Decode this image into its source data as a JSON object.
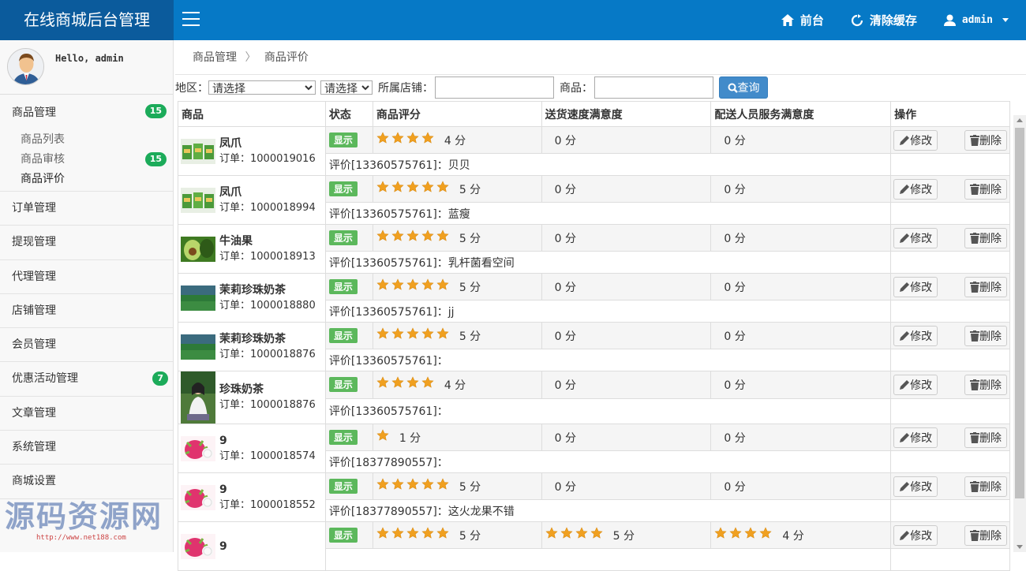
{
  "header": {
    "brand": "在线商城后台管理",
    "frontend": "前台",
    "clear_cache": "清除缓存",
    "user": "admin"
  },
  "sidebar": {
    "hello": "Hello, admin",
    "menu": [
      {
        "label": "商品管理",
        "badge": "15",
        "sub": [
          {
            "label": "商品列表"
          },
          {
            "label": "商品审核",
            "badge": "15"
          },
          {
            "label": "商品评价"
          }
        ]
      },
      {
        "label": "订单管理"
      },
      {
        "label": "提现管理"
      },
      {
        "label": "代理管理"
      },
      {
        "label": "店铺管理"
      },
      {
        "label": "会员管理"
      },
      {
        "label": "优惠活动管理",
        "badge": "7"
      },
      {
        "label": "文章管理"
      },
      {
        "label": "系统管理"
      },
      {
        "label": "商城设置"
      }
    ]
  },
  "breadcrumb": {
    "parent": "商品管理",
    "current": "商品评价",
    "sep": "〉"
  },
  "filter": {
    "region_label": "地区：",
    "region_select": "请选择",
    "sub_select": "请选择",
    "shop_label": "所属店铺：",
    "product_label": "商品：",
    "query_button": "查询"
  },
  "table": {
    "headers": [
      "商品",
      "状态",
      "商品评分",
      "送货速度满意度",
      "配送人员服务满意度",
      "操作"
    ],
    "status_label": "显示",
    "order_prefix": "订单：",
    "edit": "修改",
    "delete": "删除",
    "rows": [
      {
        "name": "凤爪",
        "order": "1000019016",
        "rating": 4,
        "rating_text": "4 分",
        "speed": 0,
        "speed_text": "0 分",
        "service": 0,
        "service_text": "0 分",
        "eval": "评价[13360575761]：贝贝",
        "img": "box-green"
      },
      {
        "name": "凤爪",
        "order": "1000018994",
        "rating": 5,
        "rating_text": "5 分",
        "speed": 0,
        "speed_text": "0 分",
        "service": 0,
        "service_text": "0 分",
        "eval": "评价[13360575761]：蓝瘦",
        "img": "box-green"
      },
      {
        "name": "牛油果",
        "order": "1000018913",
        "rating": 5,
        "rating_text": "5 分",
        "speed": 0,
        "speed_text": "0 分",
        "service": 0,
        "service_text": "0 分",
        "eval": "评价[13360575761]：乳杆菌看空间",
        "img": "avocado"
      },
      {
        "name": "茉莉珍珠奶茶",
        "order": "1000018880",
        "rating": 5,
        "rating_text": "5 分",
        "speed": 0,
        "speed_text": "0 分",
        "service": 0,
        "service_text": "0 分",
        "eval": "评价[13360575761]：jj",
        "img": "field"
      },
      {
        "name": "茉莉珍珠奶茶",
        "order": "1000018876",
        "rating": 5,
        "rating_text": "5 分",
        "speed": 0,
        "speed_text": "0 分",
        "service": 0,
        "service_text": "0 分",
        "eval": "评价[13360575761]：",
        "img": "field"
      },
      {
        "name": "珍珠奶茶",
        "order": "1000018876",
        "rating": 4,
        "rating_text": "4 分",
        "speed": 0,
        "speed_text": "0 分",
        "service": 0,
        "service_text": "0 分",
        "eval": "评价[13360575761]：",
        "img": "person",
        "tall": true
      },
      {
        "name": "9",
        "order": "1000018574",
        "rating": 1,
        "rating_text": "1 分",
        "speed": 0,
        "speed_text": "0 分",
        "service": 0,
        "service_text": "0 分",
        "eval": "评价[18377890557]：",
        "img": "dragonfruit"
      },
      {
        "name": "9",
        "order": "1000018552",
        "rating": 5,
        "rating_text": "5 分",
        "speed": 0,
        "speed_text": "0 分",
        "service": 0,
        "service_text": "0 分",
        "eval": "评价[18377890557]：这火龙果不错",
        "img": "dragonfruit"
      },
      {
        "name": "9",
        "order": "",
        "rating": 5,
        "rating_text": "5 分",
        "speed": 4,
        "speed_text": "5 分",
        "service": 4,
        "service_text": "4 分",
        "eval": "",
        "img": "dragonfruit"
      }
    ]
  },
  "watermark": {
    "text": "源码资源网",
    "url": "http://www.net188.com"
  },
  "colors": {
    "topbar": "#0679c6",
    "brand": "#0b5b9c",
    "badge": "#1cab5a",
    "status": "#5cb85c",
    "star": "#f0a020",
    "query": "#428bca"
  }
}
